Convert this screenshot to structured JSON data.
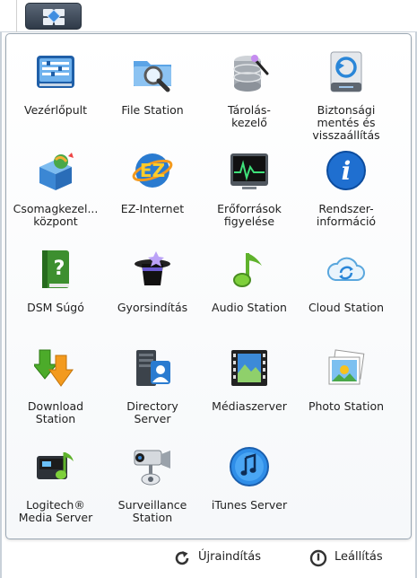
{
  "apps": [
    {
      "name": "Vezérlőpult",
      "icon": "control-panel-icon"
    },
    {
      "name": "File Station",
      "icon": "folder-search-icon"
    },
    {
      "name": "Tárolás-\nkezelő",
      "icon": "storage-manager-icon"
    },
    {
      "name": "Biztonsági\nmentés és\nvisszaállítás",
      "icon": "backup-restore-icon"
    },
    {
      "name": "Csomagkezel...\nközpont",
      "icon": "package-center-icon"
    },
    {
      "name": "EZ-Internet",
      "icon": "ez-internet-icon"
    },
    {
      "name": "Erőforrások\nfigyelése",
      "icon": "resource-monitor-icon"
    },
    {
      "name": "Rendszer-\ninformáció",
      "icon": "system-info-icon"
    },
    {
      "name": "DSM Súgó",
      "icon": "help-book-icon"
    },
    {
      "name": "Gyorsindítás",
      "icon": "magic-hat-icon"
    },
    {
      "name": "Audio Station",
      "icon": "music-note-icon"
    },
    {
      "name": "Cloud Station",
      "icon": "cloud-sync-icon"
    },
    {
      "name": "Download\nStation",
      "icon": "download-arrows-icon"
    },
    {
      "name": "Directory\nServer",
      "icon": "directory-server-icon"
    },
    {
      "name": "Médiaszerver",
      "icon": "film-strip-icon"
    },
    {
      "name": "Photo Station",
      "icon": "photo-stack-icon"
    },
    {
      "name": "Logitech®\nMedia Server",
      "icon": "logitech-media-icon"
    },
    {
      "name": "Surveillance\nStation",
      "icon": "security-camera-icon"
    },
    {
      "name": "iTunes Server",
      "icon": "itunes-icon"
    }
  ],
  "footer": {
    "restart_label": "Újraindítás",
    "shutdown_label": "Leállítás"
  }
}
